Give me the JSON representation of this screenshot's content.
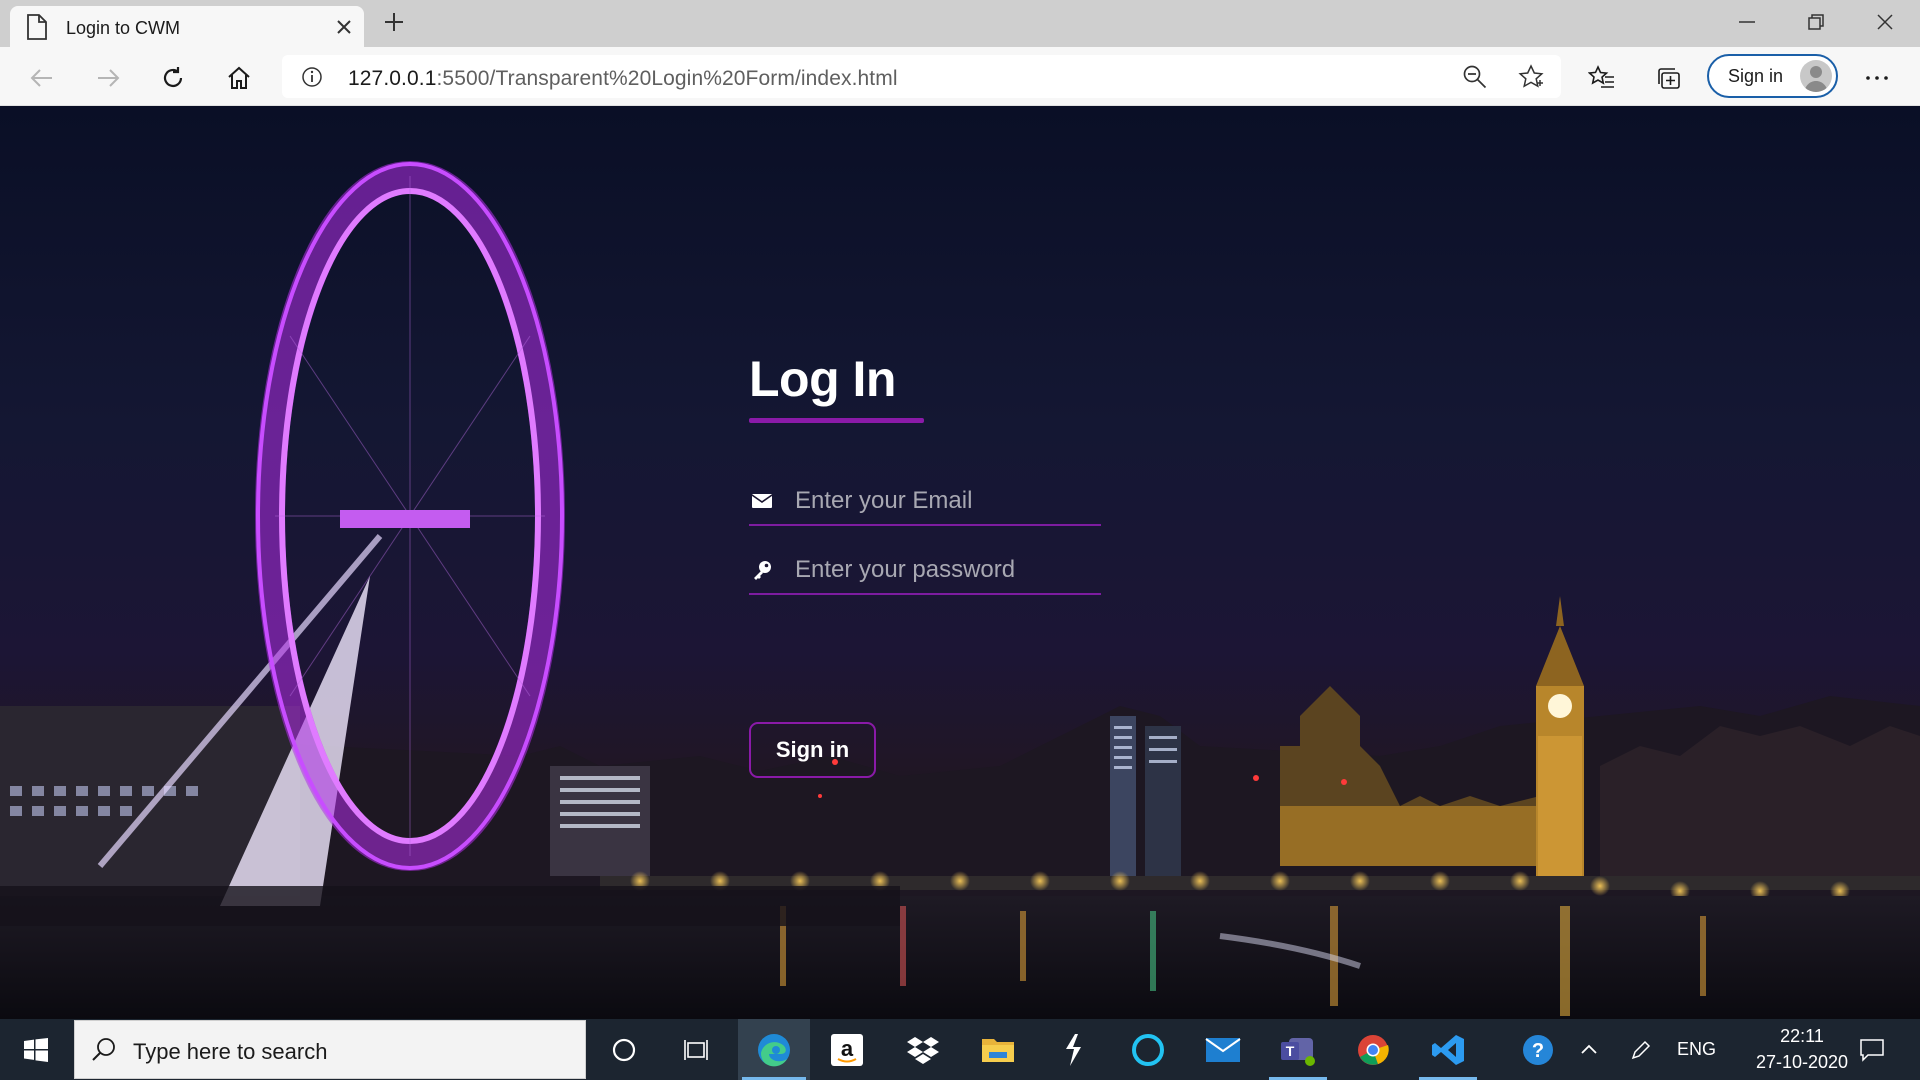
{
  "browser": {
    "tab_title": "Login to CWM",
    "url_host": "127.0.0.1",
    "url_path": ":5500/Transparent%20Login%20Form/index.html",
    "profile_button_label": "Sign in"
  },
  "login": {
    "title": "Log In",
    "email_placeholder": "Enter your Email",
    "password_placeholder": "Enter your password",
    "submit_label": "Sign in"
  },
  "taskbar": {
    "search_placeholder": "Type here to search",
    "language": "ENG",
    "time": "22:11",
    "date": "27-10-2020"
  },
  "colors": {
    "accent": "#8a1aa8",
    "wheel": "#c43dff",
    "browser_signin_border": "#1a5fa8"
  }
}
